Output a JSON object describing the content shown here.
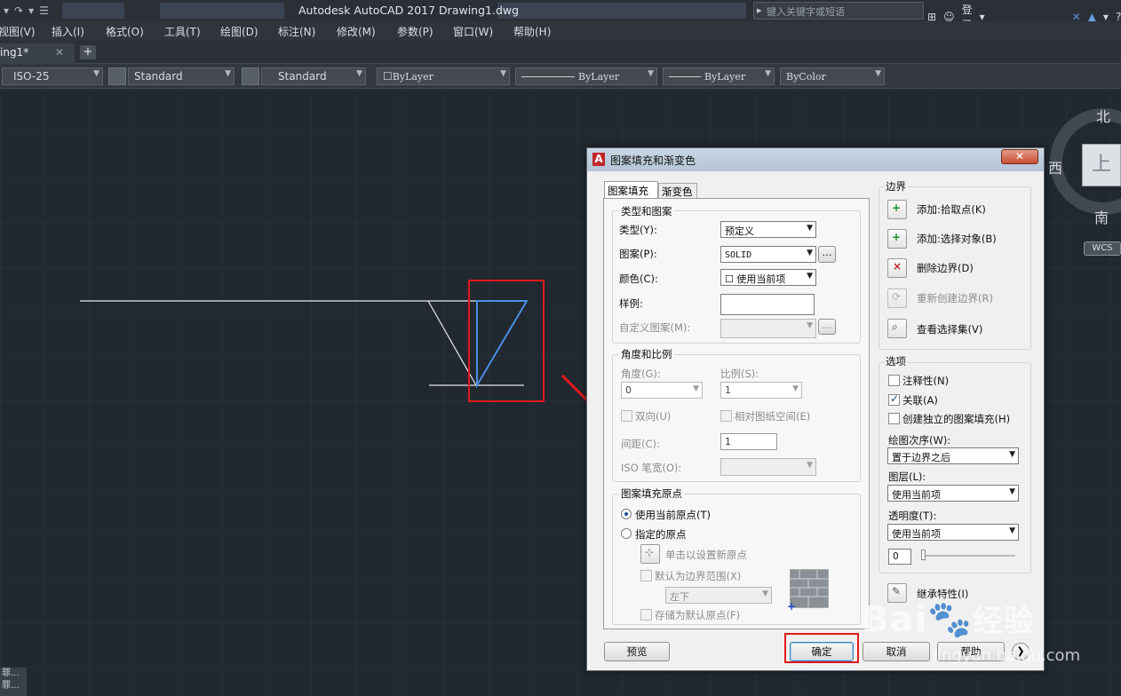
{
  "titlebar": {
    "title": "Autodesk AutoCAD 2017    Drawing1.dwg",
    "search_placeholder": "键入关键字或短语",
    "login": "登录"
  },
  "menubar": [
    "视图(V)",
    "插入(I)",
    "格式(O)",
    "工具(T)",
    "绘图(D)",
    "标注(N)",
    "修改(M)",
    "参数(P)",
    "窗口(W)",
    "帮助(H)"
  ],
  "tabs": {
    "active": "ing1*",
    "close": "✕",
    "add": "+"
  },
  "toolbar": {
    "dimstyle": "ISO-25",
    "textstyle": "Standard",
    "tablestyle": "Standard",
    "layer": "ByLayer",
    "linetype": "ByLayer",
    "lineweight": "ByLayer",
    "plotstyle": "ByColor"
  },
  "viewcube": {
    "north": "北",
    "west": "西",
    "south": "南",
    "top": "上",
    "wcs": "WCS"
  },
  "dialog": {
    "title": "图案填充和渐变色",
    "tabs": [
      "图案填充",
      "渐变色"
    ],
    "type_pattern": {
      "group": "类型和图案",
      "type_label": "类型(Y):",
      "type_value": "预定义",
      "pattern_label": "图案(P):",
      "pattern_value": "SOLID",
      "pattern_browse": "...",
      "color_label": "颜色(C):",
      "color_value": "使用当前项",
      "swatch_label": "样例:",
      "custom_label": "自定义图案(M):",
      "custom_browse": "..."
    },
    "angle_scale": {
      "group": "角度和比例",
      "angle_label": "角度(G):",
      "angle_value": "0",
      "scale_label": "比例(S):",
      "scale_value": "1",
      "double_label": "双向(U)",
      "relative_label": "相对图纸空间(E)",
      "spacing_label": "间距(C):",
      "spacing_value": "1",
      "iso_label": "ISO 笔宽(O):"
    },
    "origin": {
      "group": "图案填充原点",
      "current_label": "使用当前原点(T)",
      "specified_label": "指定的原点",
      "click_set_label": "单击以设置新原点",
      "default_extent_label": "默认为边界范围(X)",
      "position_value": "左下",
      "store_label": "存储为默认原点(F)"
    },
    "boundary": {
      "group": "边界",
      "add_pick": "添加:拾取点(K)",
      "add_select": "添加:选择对象(B)",
      "remove": "删除边界(D)",
      "recreate": "重新创建边界(R)",
      "view_sel": "查看选择集(V)"
    },
    "options": {
      "group": "选项",
      "annotative": "注释性(N)",
      "associative": "关联(A)",
      "separate": "创建独立的图案填充(H)",
      "draw_order_label": "绘图次序(W):",
      "draw_order_value": "置于边界之后",
      "layer_label": "图层(L):",
      "layer_value": "使用当前项",
      "transparency_label": "透明度(T):",
      "transparency_value": "使用当前项",
      "transparency_number": "0"
    },
    "inherit": "继承特性(I)",
    "preview": "预览",
    "ok": "确定",
    "cancel": "取消",
    "help": "帮助"
  },
  "watermark": {
    "brand": "Bai",
    "brand2": "经验",
    "url": "jingyan.baidu.com"
  },
  "colors": {
    "highlight": "#e1191c",
    "selection": "#4a90e2"
  }
}
